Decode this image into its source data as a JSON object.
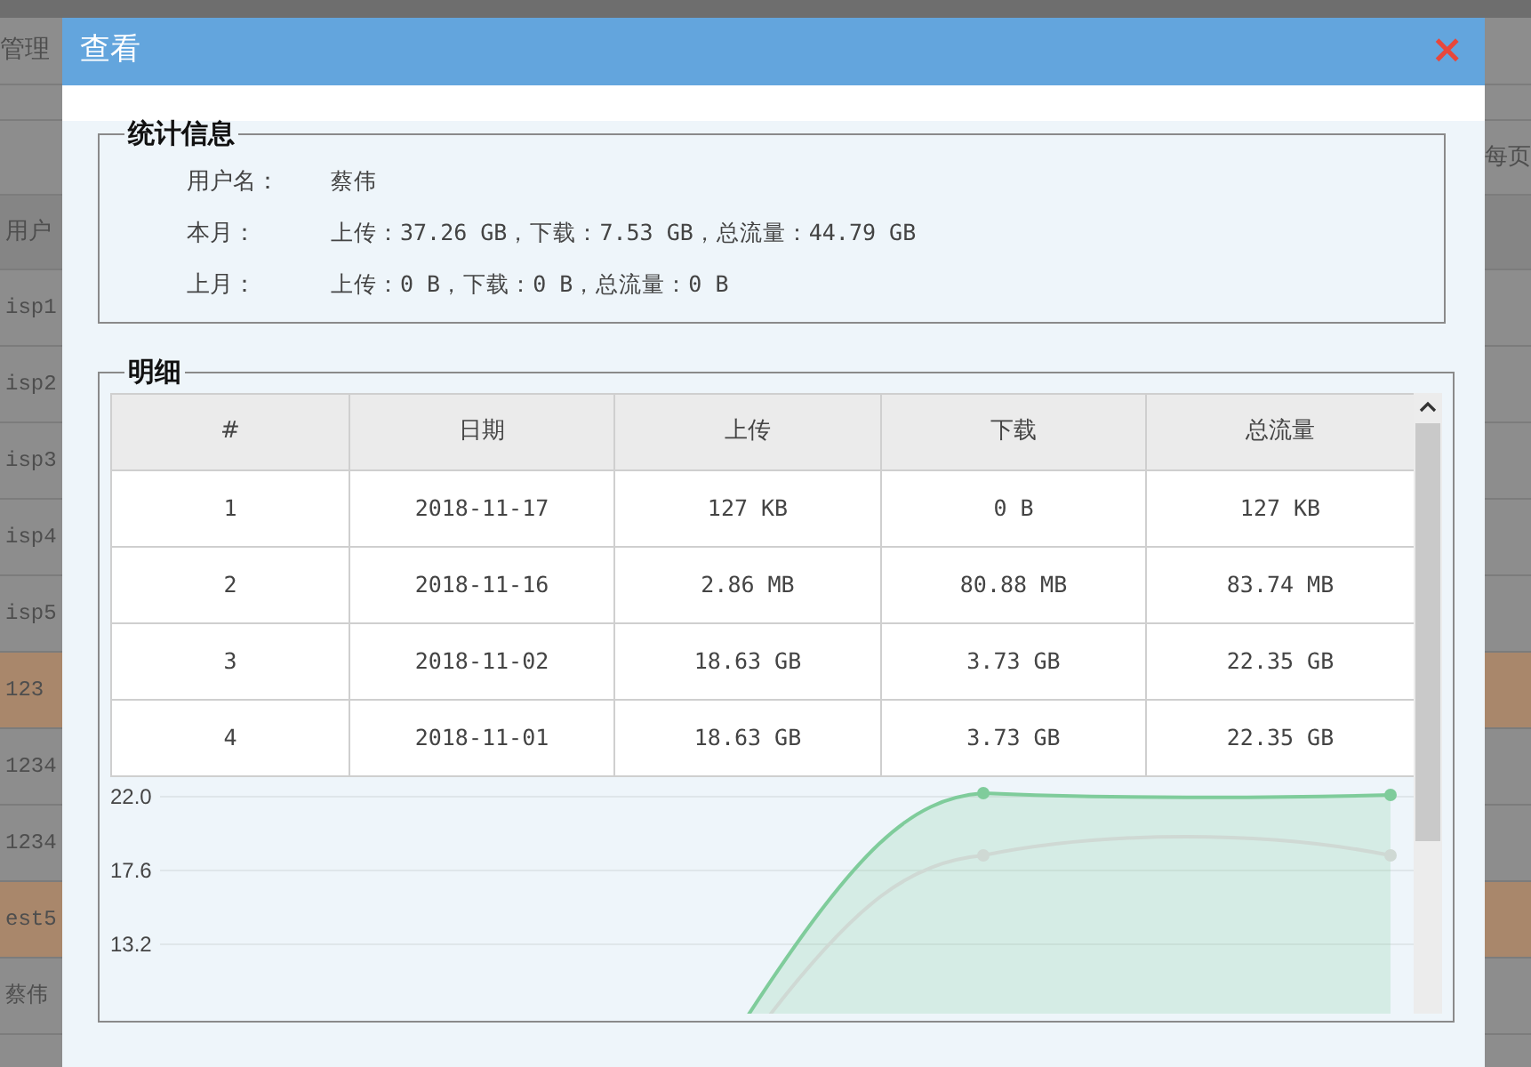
{
  "background_page": {
    "title": "管理",
    "page_size_label": "每页",
    "column_header": "用户",
    "rows": [
      {
        "text": "isp1",
        "highlighted": false
      },
      {
        "text": "isp2",
        "highlighted": false
      },
      {
        "text": "isp3",
        "highlighted": false
      },
      {
        "text": "isp4",
        "highlighted": false
      },
      {
        "text": "isp5",
        "highlighted": false
      },
      {
        "text": "123",
        "highlighted": true
      },
      {
        "text": "1234",
        "highlighted": false
      },
      {
        "text": "1234",
        "highlighted": false
      },
      {
        "text": "est5",
        "highlighted": true
      },
      {
        "text": "蔡伟",
        "highlighted": false
      }
    ]
  },
  "dialog": {
    "title": "查看",
    "close": "×",
    "summary": {
      "legend": "统计信息",
      "rows": [
        {
          "label": "用户名：",
          "value": "蔡伟"
        },
        {
          "label": "本月：",
          "value": "上传：37.26 GB，下载：7.53 GB，总流量：44.79 GB"
        },
        {
          "label": "上月：",
          "value": "上传：0 B，下载：0 B，总流量：0 B"
        }
      ]
    },
    "detail": {
      "legend": "明细",
      "table": {
        "columns": [
          "#",
          "日期",
          "上传",
          "下载",
          "总流量"
        ],
        "rows": [
          [
            "1",
            "2018-11-17",
            "127 KB",
            "0 B",
            "127 KB"
          ],
          [
            "2",
            "2018-11-16",
            "2.86 MB",
            "80.88 MB",
            "83.74 MB"
          ],
          [
            "3",
            "2018-11-02",
            "18.63 GB",
            "3.73 GB",
            "22.35 GB"
          ],
          [
            "4",
            "2018-11-01",
            "18.63 GB",
            "3.73 GB",
            "22.35 GB"
          ]
        ]
      },
      "chart": {
        "y_axis_labels": [
          "22.0",
          "17.6",
          "13.2"
        ]
      }
    }
  }
}
